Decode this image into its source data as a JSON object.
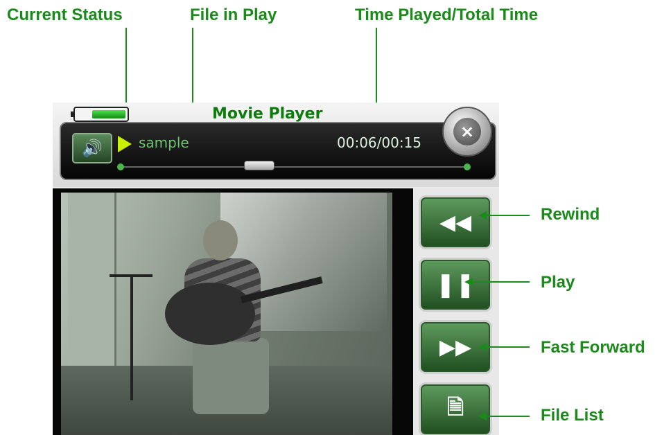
{
  "callouts": {
    "current_status": "Current Status",
    "file_in_play": "File in Play",
    "time_played": "Time Played/Total Time",
    "rewind": "Rewind",
    "play": "Play",
    "fast_forward": "Fast Forward",
    "file_list": "File List"
  },
  "player": {
    "title": "Movie Player",
    "file_name": "sample",
    "time_display": "00:06/00:15",
    "close_symbol": "×",
    "volume_symbol": "🔊",
    "battery_level": 0.6,
    "seek_position": 0.4
  },
  "controls": {
    "rewind_symbol": "◀◀",
    "pause_symbol": "❚❚",
    "ff_symbol": "▶▶",
    "filelist_symbol": "🗎"
  },
  "icons": [
    "battery-icon",
    "volume-icon",
    "play-status-icon",
    "close-icon",
    "rewind-icon",
    "pause-icon",
    "fast-forward-icon",
    "file-list-icon"
  ],
  "colors": {
    "callout_green": "#1a8a1a",
    "title_green": "#0f7a0f",
    "button_green": "#2f6a2f",
    "status_play": "#c8f000"
  }
}
